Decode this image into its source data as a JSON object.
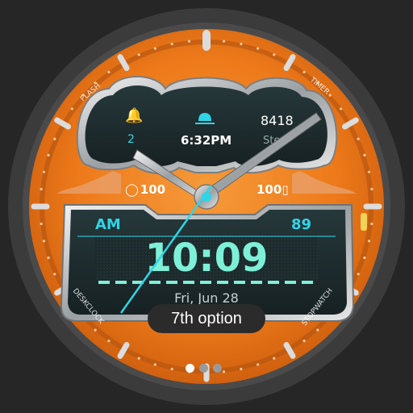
{
  "colors": {
    "background": "#262626",
    "bezel": "#3a3a3a",
    "dial_orange": "#f07a1c",
    "accent_cyan": "#2fd5e6",
    "digit_mint": "#7ef0d8",
    "panel_dark": "#1f2a2c"
  },
  "complications": {
    "alarm": {
      "icon": "alarm-bell-icon",
      "value": "2"
    },
    "next_event": {
      "icon": "cap-icon",
      "value": "6:32PM"
    },
    "steps": {
      "value": "8418",
      "label": "Ste"
    }
  },
  "battery": {
    "watch_label": "100",
    "phone_label": "100"
  },
  "bezel_labels": {
    "top_left": "FLASH",
    "top_right": "TIMER",
    "bottom_left": "DESKCLOCK",
    "bottom_right": "STOPWATCH"
  },
  "digital": {
    "ampm": "AM",
    "right_value": "89",
    "time": "10:09",
    "date": "Fri, Jun 28"
  },
  "toast": {
    "label": "7th option"
  },
  "pager": {
    "count": 3,
    "active_index": 0
  }
}
